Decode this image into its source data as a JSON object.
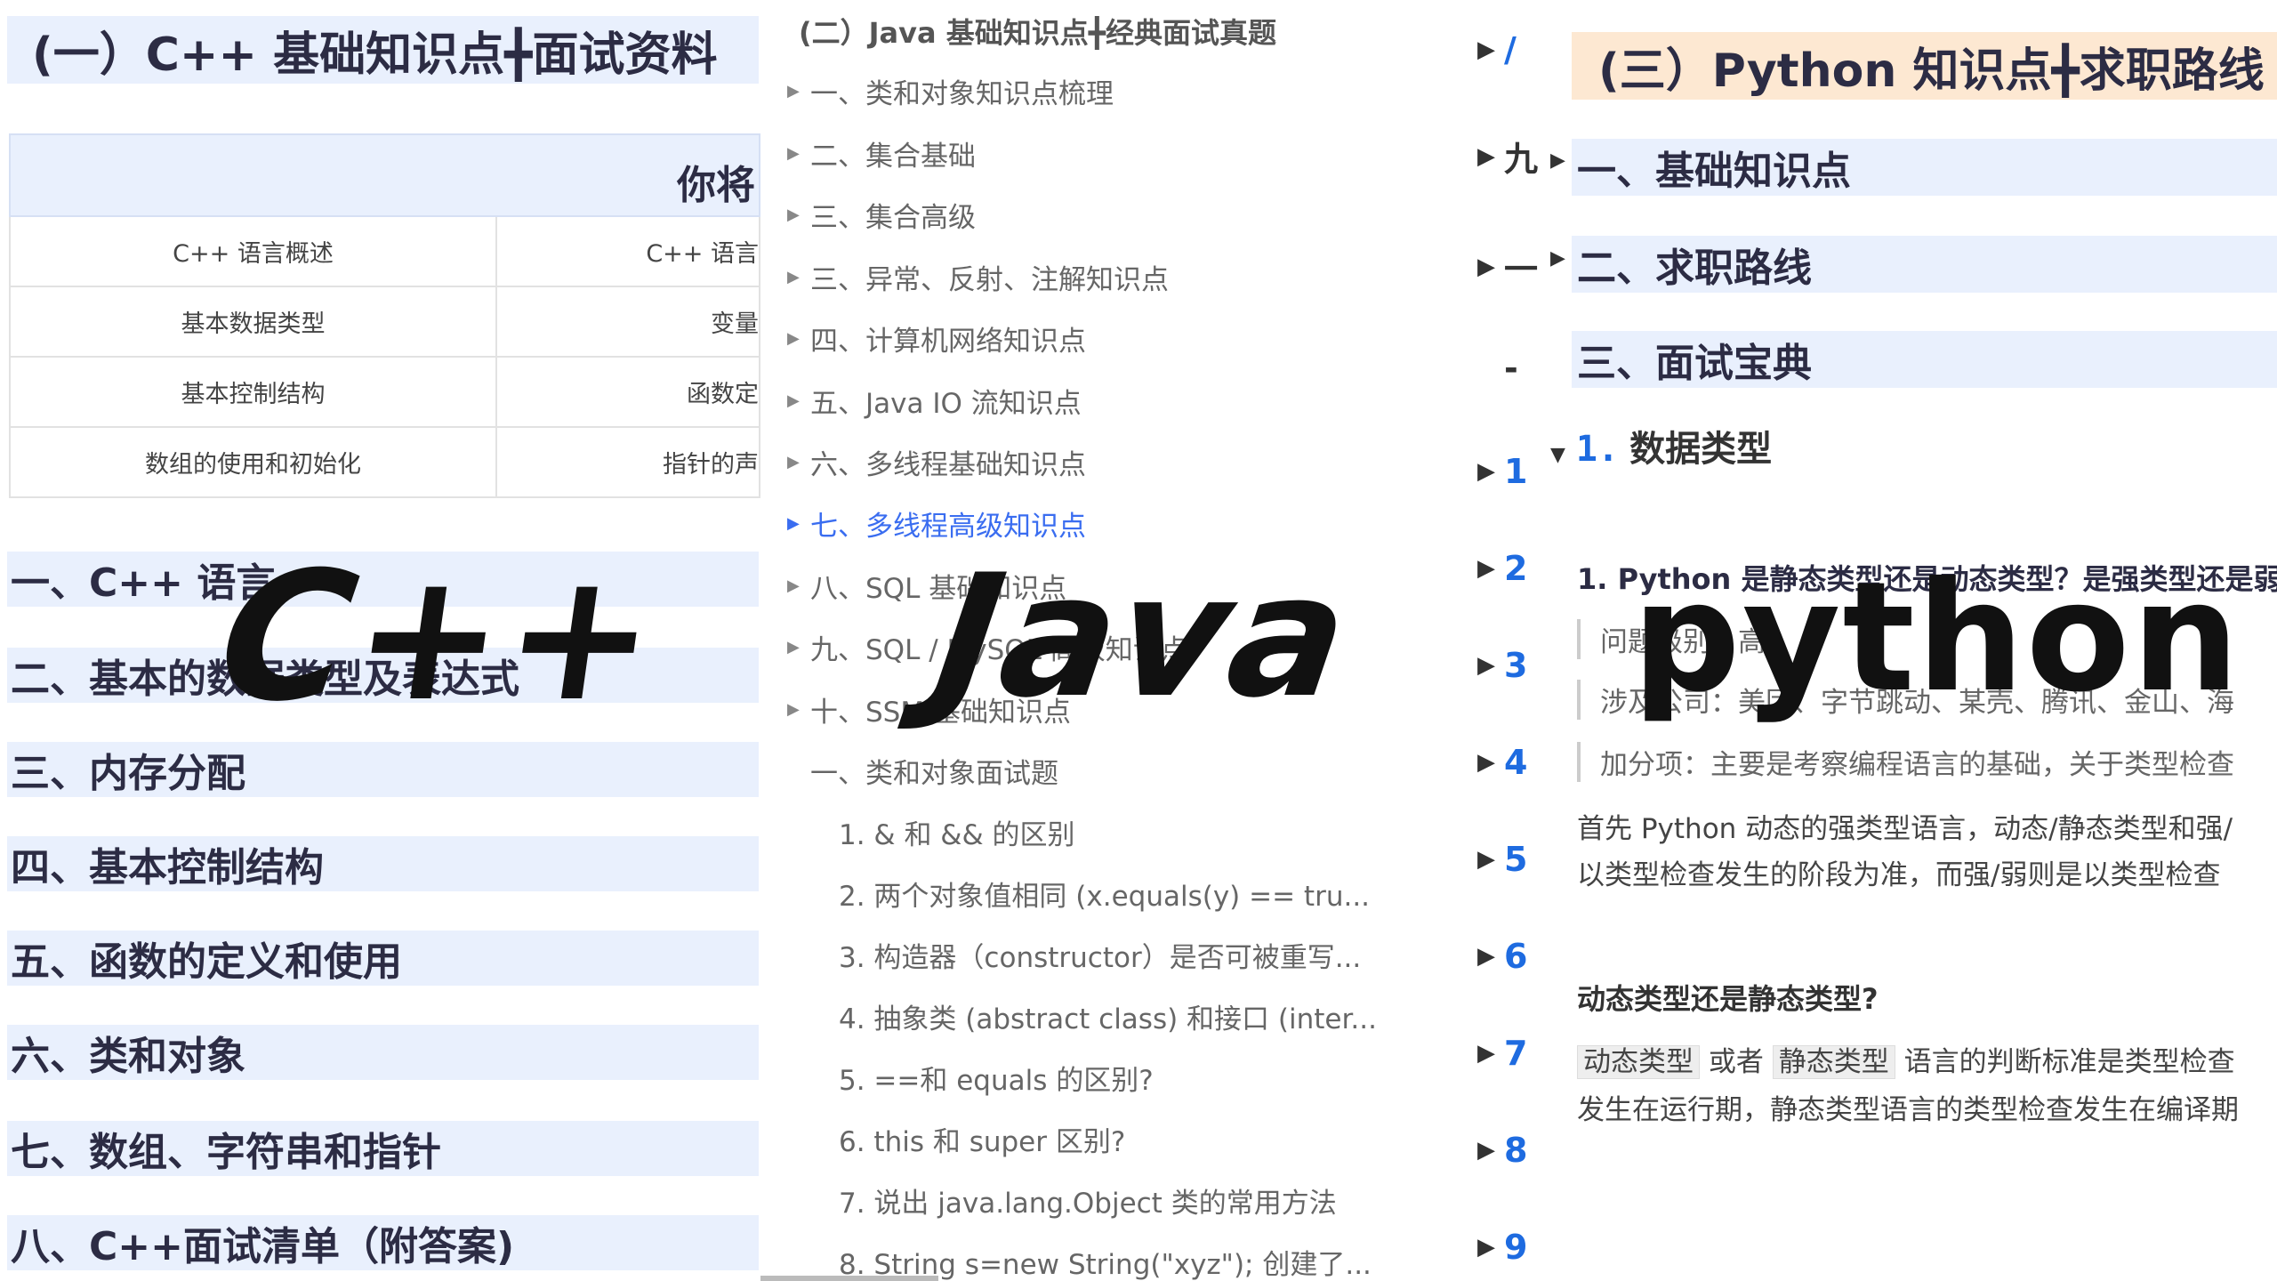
{
  "cpp": {
    "title": "(一）C++ 基础知识点╋面试资料",
    "table_header": "你将",
    "table_rows": [
      {
        "c1": "C++ 语言概述",
        "c2": "C++ 语言"
      },
      {
        "c1": "基本数据类型",
        "c2": "变量"
      },
      {
        "c1": "基本控制结构",
        "c2": "函数定"
      },
      {
        "c1": "数组的使用和初始化",
        "c2": "指针的声"
      }
    ],
    "sections": [
      "一、C++ 语言",
      "二、基本的数据类型及表达式",
      "三、内存分配",
      "四、基本控制结构",
      "五、函数的定义和使用",
      "六、类和对象",
      "七、数组、字符串和指针",
      "八、C++面试清单（附答案)"
    ],
    "logo": "C++"
  },
  "java": {
    "title": "(二）Java 基础知识点╋经典面试真题",
    "items": [
      {
        "label": "一、类和对象知识点梳理"
      },
      {
        "label": "二、集合基础"
      },
      {
        "label": "三、集合高级"
      },
      {
        "label": "三、异常、反射、注解知识点"
      },
      {
        "label": "四、计算机网络知识点"
      },
      {
        "label": "五、Java IO 流知识点"
      },
      {
        "label": "六、多线程基础知识点"
      },
      {
        "label": "七、多线程高级知识点"
      },
      {
        "label": "八、SQL 基础知识点"
      },
      {
        "label": "九、SQL / MySQL 高级知识点"
      },
      {
        "label": "十、SSM 基础知识点"
      }
    ],
    "subheading": "一、类和对象面试题",
    "subitems": [
      "1. & 和 && 的区别",
      "2. 两个对象值相同 (x.equals(y) == tru...",
      "3. 构造器（constructor）是否可被重写...",
      "4. 抽象类 (abstract class) 和接口 (inter...",
      "5. ==和 equals 的区别?",
      "6. this 和 super 区别?",
      "7. 说出 java.lang.Object 类的常用方法",
      "8. String s=new String(\"xyz\"); 创建了..."
    ],
    "logo": "Java"
  },
  "python": {
    "strip": [
      "/",
      "九",
      "一",
      "-",
      "1",
      "2",
      "3",
      "4",
      "5",
      "6",
      "7",
      "8",
      "9"
    ],
    "title": "(三）Python 知识点╋求职路线",
    "sections": [
      "一、基础知识点",
      "二、求职路线",
      "三、面试宝典"
    ],
    "h3_num": "1.",
    "h3_text": "数据类型",
    "question": "1. Python 是静态类型还是动态类型？是强类型还是弱",
    "quotes": [
      "问题级别：高",
      "涉及公司：美团、字节跳动、某壳、腾讯、金山、海",
      "加分项：主要是考察编程语言的基础，关于类型检查"
    ],
    "para1_line1": "首先 Python 动态的强类型语言，动态/静态类型和强/",
    "para1_line2": "以类型检查发生的阶段为准，而强/弱则是以类型检查",
    "h4": "动态类型还是静态类型?",
    "code1": "动态类型",
    "or_text": "或者",
    "code2": "静态类型",
    "para2_tail": "语言的判断标准是类型检查",
    "para2_line2": "发生在运行期，静态类型语言的类型检查发生在编译期",
    "logo": "python"
  }
}
